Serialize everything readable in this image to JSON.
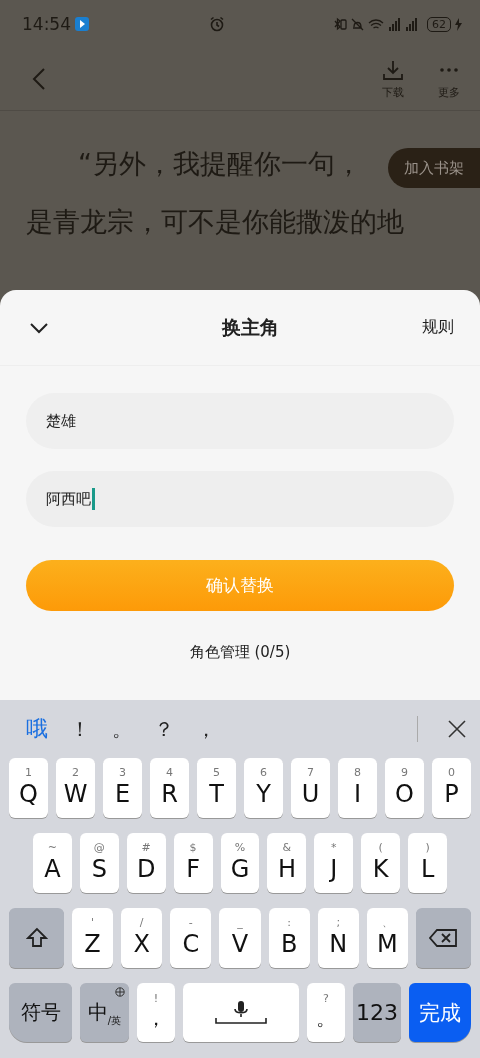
{
  "status_bar": {
    "time": "14:54",
    "battery": "62"
  },
  "header": {
    "actions": [
      {
        "label": "下载",
        "kind": "download"
      },
      {
        "label": "更多",
        "kind": "more"
      }
    ]
  },
  "reader": {
    "paragraphs": [
      "“另外，我提醒你一句，",
      "是青龙宗，可不是你能撒泼的地"
    ],
    "bookshelf_button": "加入书架"
  },
  "sheet": {
    "title": "换主角",
    "rules_link": "规则",
    "fields": [
      {
        "value": "楚雄",
        "focused": false
      },
      {
        "value": "阿西吧",
        "focused": true
      }
    ],
    "confirm_button": "确认替换",
    "manage_link": "角色管理 (0/5)"
  },
  "keyboard": {
    "candidates": [
      {
        "text": "哦",
        "kind": "word"
      },
      {
        "text": "！",
        "kind": "punct"
      },
      {
        "text": "。",
        "kind": "punct"
      },
      {
        "text": "？",
        "kind": "punct"
      },
      {
        "text": "，",
        "kind": "punct"
      }
    ],
    "rows": [
      [
        {
          "label": "Q",
          "hint": "1"
        },
        {
          "label": "W",
          "hint": "2"
        },
        {
          "label": "E",
          "hint": "3"
        },
        {
          "label": "R",
          "hint": "4"
        },
        {
          "label": "T",
          "hint": "5"
        },
        {
          "label": "Y",
          "hint": "6"
        },
        {
          "label": "U",
          "hint": "7"
        },
        {
          "label": "I",
          "hint": "8"
        },
        {
          "label": "O",
          "hint": "9"
        },
        {
          "label": "P",
          "hint": "0"
        }
      ],
      [
        {
          "label": "A",
          "hint": "~"
        },
        {
          "label": "S",
          "hint": "@"
        },
        {
          "label": "D",
          "hint": "#"
        },
        {
          "label": "F",
          "hint": "$"
        },
        {
          "label": "G",
          "hint": "%"
        },
        {
          "label": "H",
          "hint": "&"
        },
        {
          "label": "J",
          "hint": "*"
        },
        {
          "label": "K",
          "hint": "("
        },
        {
          "label": "L",
          "hint": ")"
        }
      ],
      [
        {
          "label": "Z",
          "hint": "'"
        },
        {
          "label": "X",
          "hint": "/"
        },
        {
          "label": "C",
          "hint": "-"
        },
        {
          "label": "V",
          "hint": "_"
        },
        {
          "label": "B",
          "hint": ":"
        },
        {
          "label": "N",
          "hint": ";"
        },
        {
          "label": "M",
          "hint": "、"
        }
      ]
    ],
    "bottom": [
      {
        "kind": "symbols",
        "label": "符号"
      },
      {
        "kind": "lang",
        "label": "中",
        "sub": "/英"
      },
      {
        "kind": "char",
        "label": "，",
        "hint": "!"
      },
      {
        "kind": "space"
      },
      {
        "kind": "char",
        "label": "。",
        "hint": "?"
      },
      {
        "kind": "numbers",
        "label": "123"
      },
      {
        "kind": "done",
        "label": "完成"
      }
    ]
  }
}
